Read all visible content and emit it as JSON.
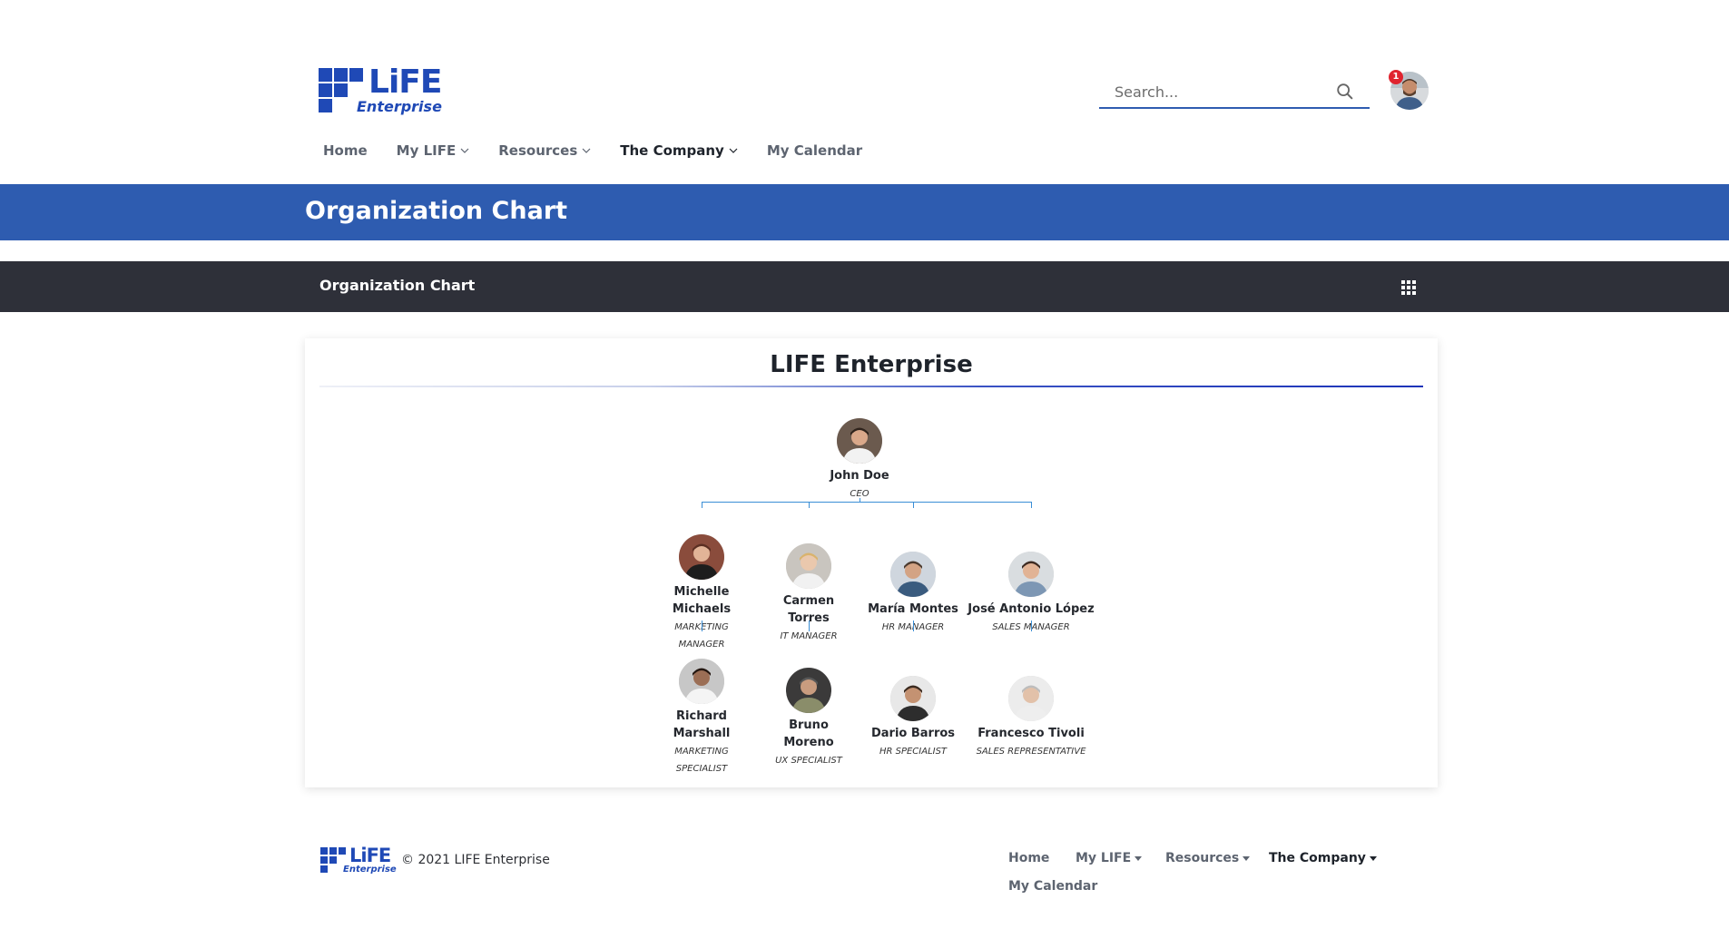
{
  "brand": {
    "logo_word": "LiFE",
    "logo_sub": "Enterprise"
  },
  "search": {
    "placeholder": "Search..."
  },
  "user": {
    "notification_count": "1"
  },
  "nav": {
    "items": [
      {
        "label": "Home",
        "dropdown": false,
        "active": false
      },
      {
        "label": "My LIFE",
        "dropdown": true,
        "active": false
      },
      {
        "label": "Resources",
        "dropdown": true,
        "active": false
      },
      {
        "label": "The Company",
        "dropdown": true,
        "active": true
      },
      {
        "label": "My Calendar",
        "dropdown": false,
        "active": false
      }
    ]
  },
  "banner": {
    "title": "Organization Chart"
  },
  "section": {
    "title": "Organization Chart",
    "menu_icon": "grid-icon"
  },
  "org_chart": {
    "title": "LIFE Enterprise",
    "root": {
      "name": "John Doe",
      "role": "CEO"
    },
    "departments": [
      {
        "manager": {
          "name_lines": [
            "Michelle",
            "Michaels"
          ],
          "role_lines": [
            "Marketing",
            "Manager"
          ]
        },
        "report": {
          "name_lines": [
            "Richard",
            "Marshall"
          ],
          "role_lines": [
            "Marketing",
            "Specialist"
          ]
        }
      },
      {
        "manager": {
          "name_lines": [
            "Carmen",
            "Torres"
          ],
          "role_lines": [
            "IT Manager"
          ]
        },
        "report": {
          "name_lines": [
            "Bruno",
            "Moreno"
          ],
          "role_lines": [
            "UX Specialist"
          ]
        }
      },
      {
        "manager": {
          "name_lines": [
            "María Montes"
          ],
          "role_lines": [
            "HR Manager"
          ]
        },
        "report": {
          "name_lines": [
            "Dario Barros"
          ],
          "role_lines": [
            "HR Specialist"
          ]
        }
      },
      {
        "manager": {
          "name_lines": [
            "José Antonio López"
          ],
          "role_lines": [
            "Sales Manager"
          ]
        },
        "report": {
          "name_lines": [
            "Francesco Tivoli"
          ],
          "role_lines": [
            "Sales Representative"
          ]
        }
      }
    ]
  },
  "footer": {
    "copyright": "© 2021 LIFE Enterprise",
    "nav": [
      {
        "label": "Home",
        "dropdown": false,
        "active": false
      },
      {
        "label": "My LIFE",
        "dropdown": true,
        "active": false
      },
      {
        "label": "Resources",
        "dropdown": true,
        "active": false
      },
      {
        "label": "The Company",
        "dropdown": true,
        "active": true
      },
      {
        "label": "My Calendar",
        "dropdown": false,
        "active": false
      }
    ]
  },
  "colors": {
    "brand_blue": "#1f49b6",
    "banner_blue": "#2e5cb0",
    "dark_bar": "#2e3039",
    "connector": "#3a8ed6",
    "badge_red": "#e0242f"
  }
}
